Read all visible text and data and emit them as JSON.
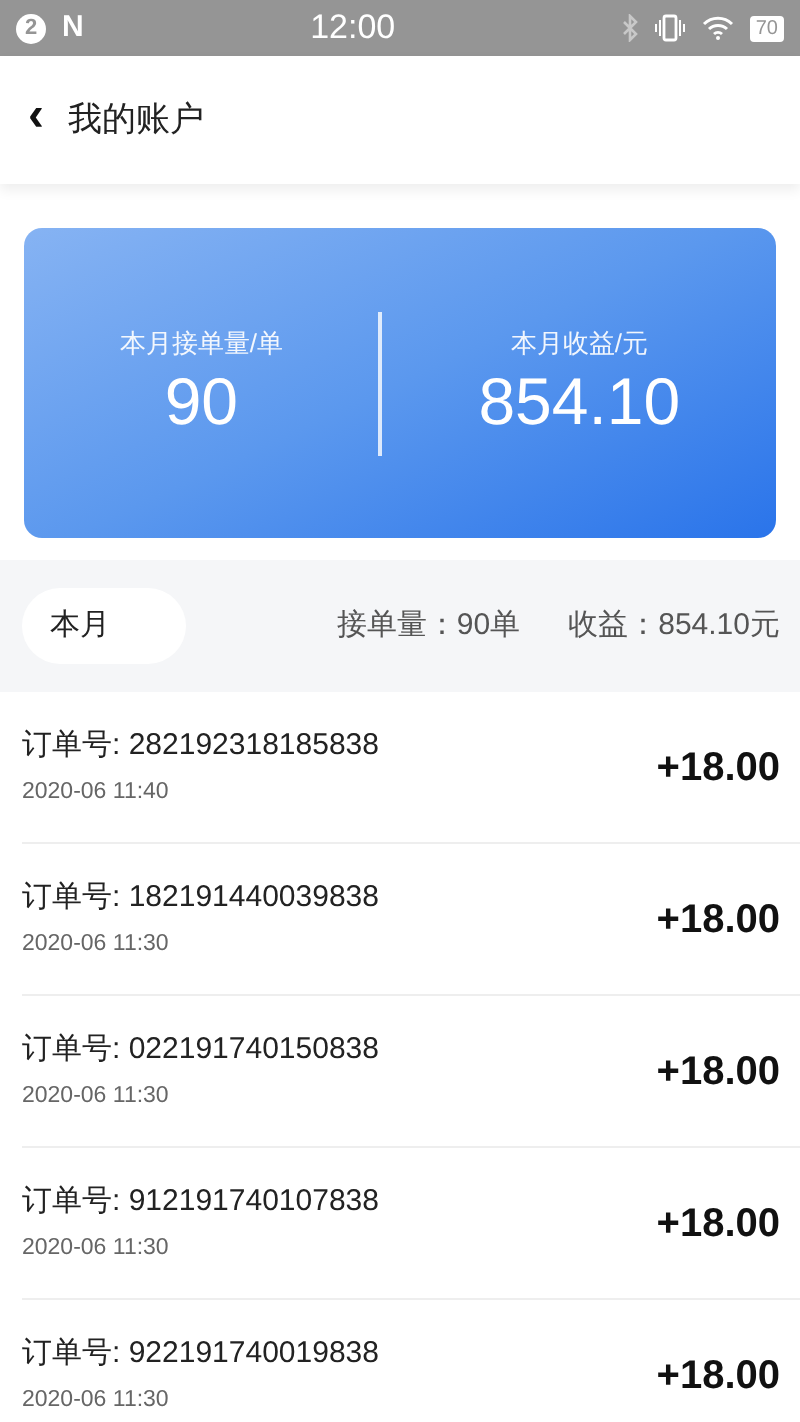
{
  "status_bar": {
    "notification_count": "2",
    "app_letter": "N",
    "time": "12:00",
    "battery": "70"
  },
  "header": {
    "back": "‹",
    "title": "我的账户"
  },
  "summary": {
    "stats": [
      {
        "label": "本月接单量/单",
        "value": "90"
      },
      {
        "label": "本月收益/元",
        "value": "854.10"
      }
    ]
  },
  "filter": {
    "period": "本月",
    "orders_total": "接单量：90单",
    "income_total": "收益：854.10元"
  },
  "orders": [
    {
      "order_no": "订单号: 282192318185838",
      "time": "2020-06 11:40",
      "amount": "+18.00"
    },
    {
      "order_no": "订单号: 182191440039838",
      "time": "2020-06 11:30",
      "amount": "+18.00"
    },
    {
      "order_no": "订单号: 022191740150838",
      "time": "2020-06 11:30",
      "amount": "+18.00"
    },
    {
      "order_no": "订单号: 912191740107838",
      "time": "2020-06 11:30",
      "amount": "+18.00"
    },
    {
      "order_no": "订单号: 922191740019838",
      "time": "2020-06 11:30",
      "amount": "+18.00"
    }
  ]
}
